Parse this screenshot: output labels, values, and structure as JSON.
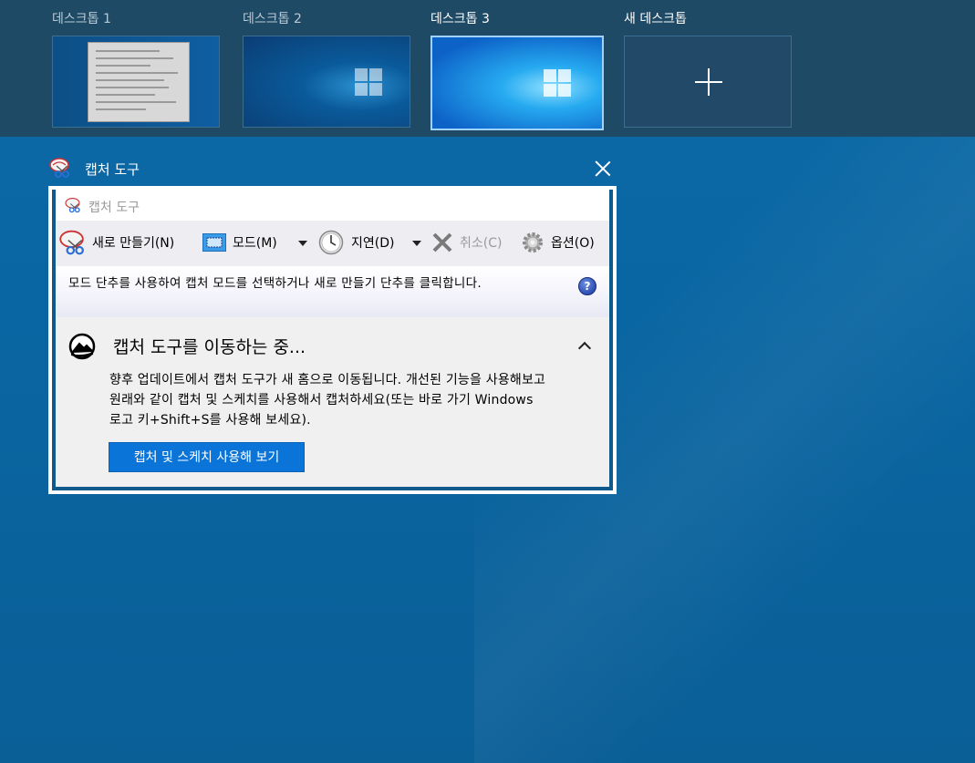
{
  "task_view": {
    "desktops": [
      {
        "label": "데스크톱 1"
      },
      {
        "label": "데스크톱 2"
      },
      {
        "label": "데스크톱 3"
      },
      {
        "label": "새 데스크톱"
      }
    ]
  },
  "window_preview": {
    "title": "캡처 도구"
  },
  "snipping_tool": {
    "title": "캡처 도구",
    "toolbar": {
      "new_label": "새로 만들기(N)",
      "mode_label": "모드(M)",
      "delay_label": "지연(D)",
      "cancel_label": "취소(C)",
      "options_label": "옵션(O)"
    },
    "info_text": "모드 단추를 사용하여 캡처 모드를 선택하거나 새로 만들기 단추를 클릭합니다.",
    "help_glyph": "?",
    "moving_panel": {
      "title": "캡처 도구를 이동하는 중...",
      "body": "향후 업데이트에서 캡처 도구가 새 홈으로 이동됩니다. 개선된 기능을 사용해보고 원래와 같이 캡처 및 스케치를 사용해서 캡처하세요(또는 바로 가기 Windows 로고 키+Shift+S를 사용해 보세요).",
      "button_label": "캡처 및 스케치 사용해 보기"
    }
  },
  "icons": {
    "app": "snipping-tool-icon",
    "close": "close-icon",
    "add": "plus-icon",
    "help": "help-icon",
    "collapse": "chevron-up-icon"
  },
  "colors": {
    "accent": "#0a74d8",
    "desktop_bg": "#0a66a2",
    "taskview_strip": "#1f4a66"
  }
}
